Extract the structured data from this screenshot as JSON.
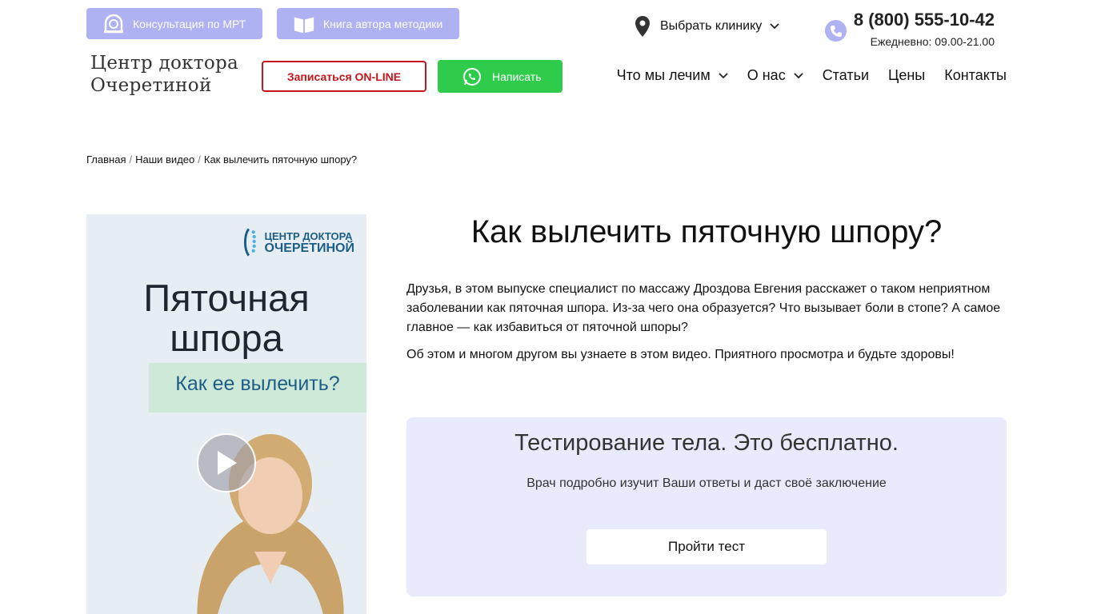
{
  "top_bar": {
    "mrt_label": "Консультация по МРТ",
    "book_label": "Книга автора методики",
    "clinic_label": "Выбрать клинику",
    "phone_number": "8 (800) 555-10-42",
    "phone_hours": "Ежедневно: 09.00-21.00"
  },
  "header": {
    "logo_line1": "Центр доктора",
    "logo_line2": "Очеретиной",
    "online_label": "Записаться ON-LINE",
    "write_label": "Написать",
    "nav": [
      {
        "label": "Что мы лечим",
        "has_dropdown": true
      },
      {
        "label": "О нас",
        "has_dropdown": true
      },
      {
        "label": "Статьи",
        "has_dropdown": false
      },
      {
        "label": "Цены",
        "has_dropdown": false
      },
      {
        "label": "Контакты",
        "has_dropdown": false
      }
    ]
  },
  "breadcrumb": {
    "items": [
      "Главная",
      "Наши видео",
      "Как вылечить пяточную шпору?"
    ],
    "separator": "/"
  },
  "video": {
    "logo_line1": "ЦЕНТР ДОКТОРА",
    "logo_line2": "ОЧЕРЕТИНОЙ",
    "title_line1": "Пяточная",
    "title_line2": "шпора",
    "subtitle": "Как ее вылечить?"
  },
  "main": {
    "title": "Как вылечить пяточную шпору?",
    "paragraph1": "Друзья, в этом выпуске специалист по массажу Дроздова Евгения расскажет о таком неприятном заболевании как пяточная шпора. Из-за чего она образуется? Что вызывает боли в стопе? А самое главное — как избавиться от пяточной шпоры?",
    "paragraph2": "Об этом и многом другом вы узнаете в этом видео. Приятного просмотра и будьте здоровы!"
  },
  "test_box": {
    "title": "Тестирование тела. Это бесплатно.",
    "description": "Врач подробно изучит Ваши ответы и даст своё заключение",
    "button_label": "Пройти тест"
  },
  "colors": {
    "pill_bg": "#aeb1f2",
    "online_border": "#c4161c",
    "whatsapp_green": "#2ecc4a",
    "test_box_bg": "#e9eafc"
  },
  "icons": {
    "mrt": "mri-scanner-icon",
    "book": "open-book-icon",
    "clinic": "location-pin-icon",
    "phone": "phone-icon",
    "write": "whatsapp-icon",
    "play": "play-icon",
    "dropdown": "chevron-down-icon"
  }
}
